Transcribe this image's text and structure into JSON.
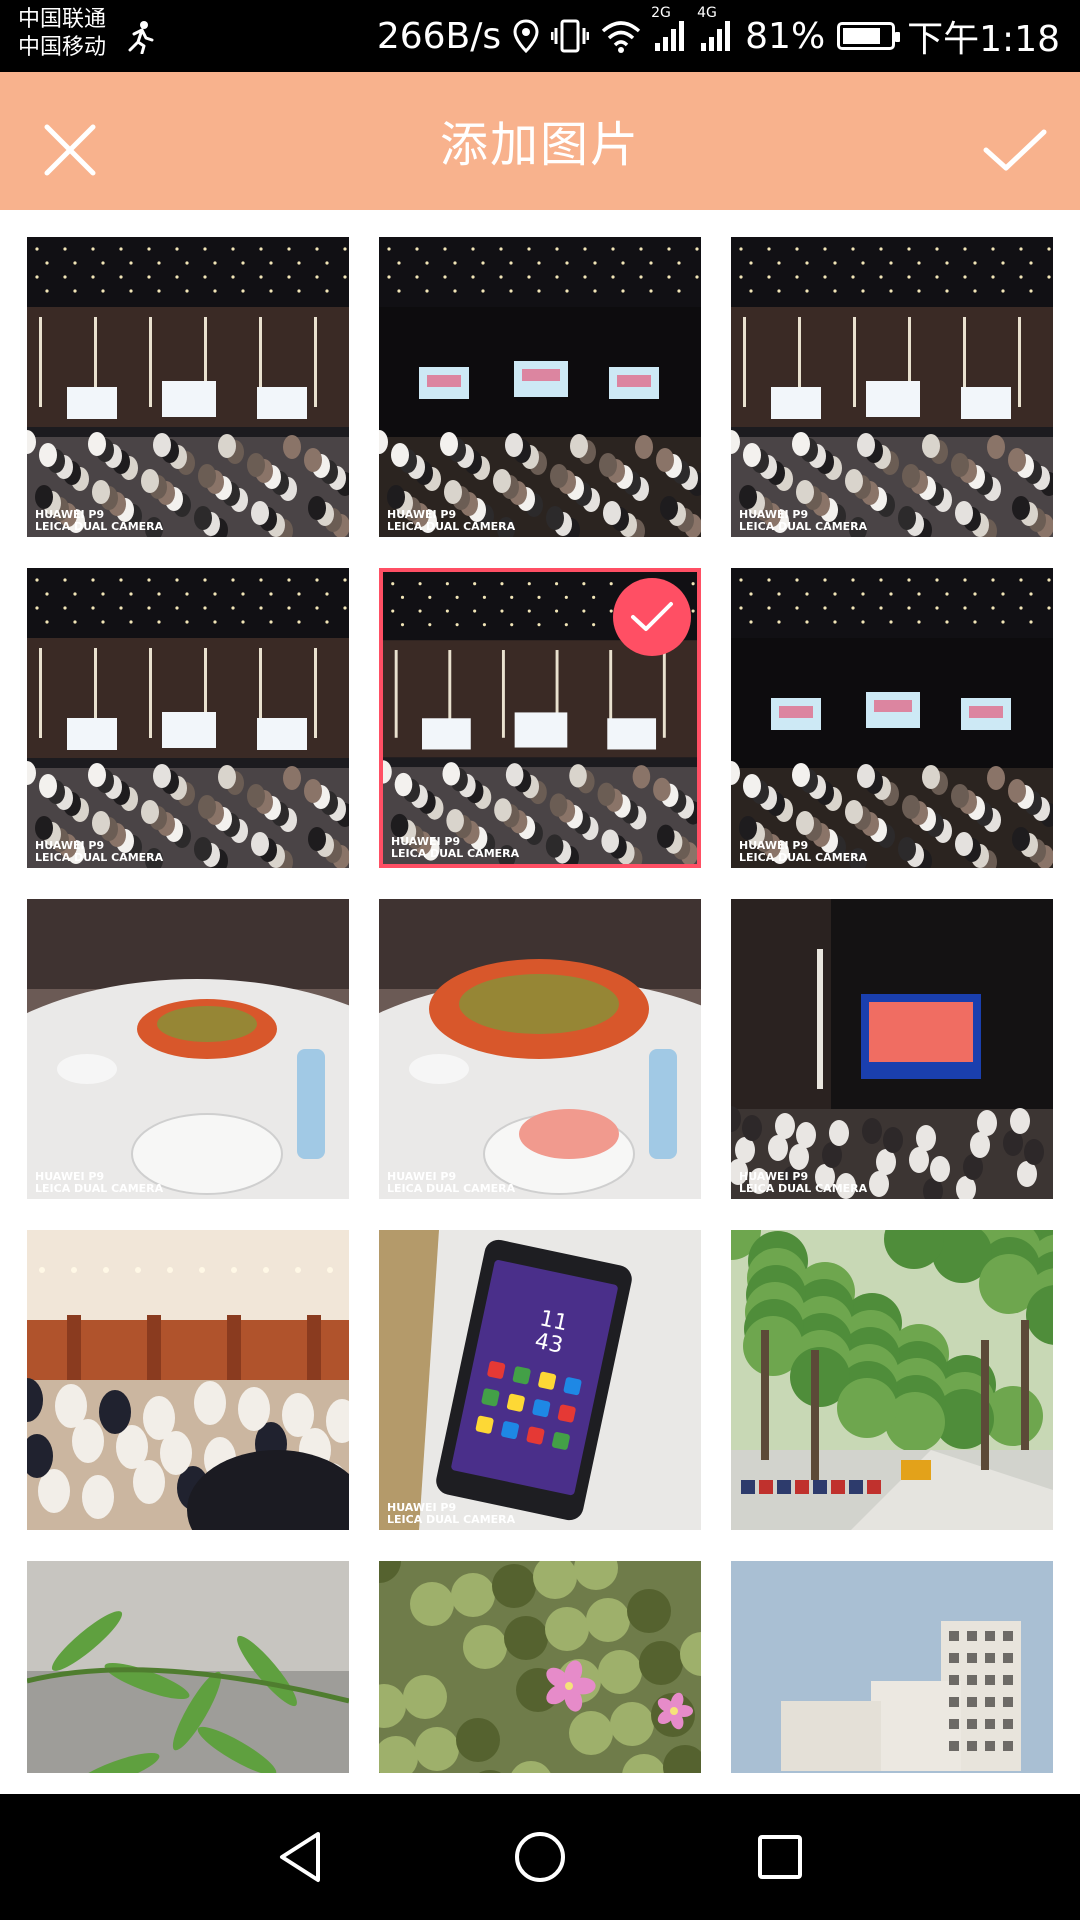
{
  "status_bar": {
    "carrier_1": "中国联通",
    "carrier_2": "中国移动",
    "network_speed": "266B/s",
    "signal_2g_label": "2G",
    "signal_4g_label": "4G",
    "battery_percent": "81%",
    "battery_level": 0.81,
    "time": "下午1:18"
  },
  "toolbar": {
    "title": "添加图片",
    "close_icon": "close-icon",
    "confirm_icon": "check-icon",
    "background_color": "#f8b28d"
  },
  "photos": [
    {
      "kind": "banquet-hall-wide",
      "watermark": [
        "HUAWEI P9",
        "LEICA DUAL CAMERA"
      ],
      "selected": false
    },
    {
      "kind": "dark-hall-screens",
      "watermark": [
        "HUAWEI P9",
        "LEICA DUAL CAMERA"
      ],
      "selected": false
    },
    {
      "kind": "banquet-hall-wide",
      "watermark": [
        "HUAWEI P9",
        "LEICA DUAL CAMERA"
      ],
      "selected": false
    },
    {
      "kind": "banquet-hall-crowd",
      "watermark": [
        "HUAWEI P9",
        "LEICA DUAL CAMERA"
      ],
      "selected": false
    },
    {
      "kind": "banquet-hall-crowd",
      "watermark": [
        "HUAWEI P9",
        "LEICA DUAL CAMERA"
      ],
      "selected": true
    },
    {
      "kind": "dark-hall-screens",
      "watermark": [
        "HUAWEI P9",
        "LEICA DUAL CAMERA"
      ],
      "selected": false
    },
    {
      "kind": "dining-table",
      "watermark": [
        "HUAWEI P9",
        "LEICA DUAL CAMERA"
      ],
      "selected": false
    },
    {
      "kind": "food-plate",
      "watermark": [
        "HUAWEI P9",
        "LEICA DUAL CAMERA"
      ],
      "selected": false
    },
    {
      "kind": "presentation-screen",
      "watermark": [
        "HUAWEI P9",
        "LEICA DUAL CAMERA"
      ],
      "selected": false
    },
    {
      "kind": "hotel-ballroom",
      "watermark": [],
      "selected": false
    },
    {
      "kind": "smartphone",
      "watermark": [
        "HUAWEI P9",
        "LEICA DUAL CAMERA"
      ],
      "selected": false,
      "phone_time": [
        "11",
        "43"
      ]
    },
    {
      "kind": "tree-road",
      "watermark": [],
      "selected": false
    },
    {
      "kind": "plant-leaves",
      "watermark": [],
      "selected": false
    },
    {
      "kind": "pink-flowers",
      "watermark": [],
      "selected": false
    },
    {
      "kind": "buildings",
      "watermark": [],
      "selected": false
    }
  ],
  "selection_color": "#ff4f64",
  "nav_bar": {
    "back_icon": "back-triangle-icon",
    "home_icon": "home-circle-icon",
    "recents_icon": "recents-square-icon"
  }
}
